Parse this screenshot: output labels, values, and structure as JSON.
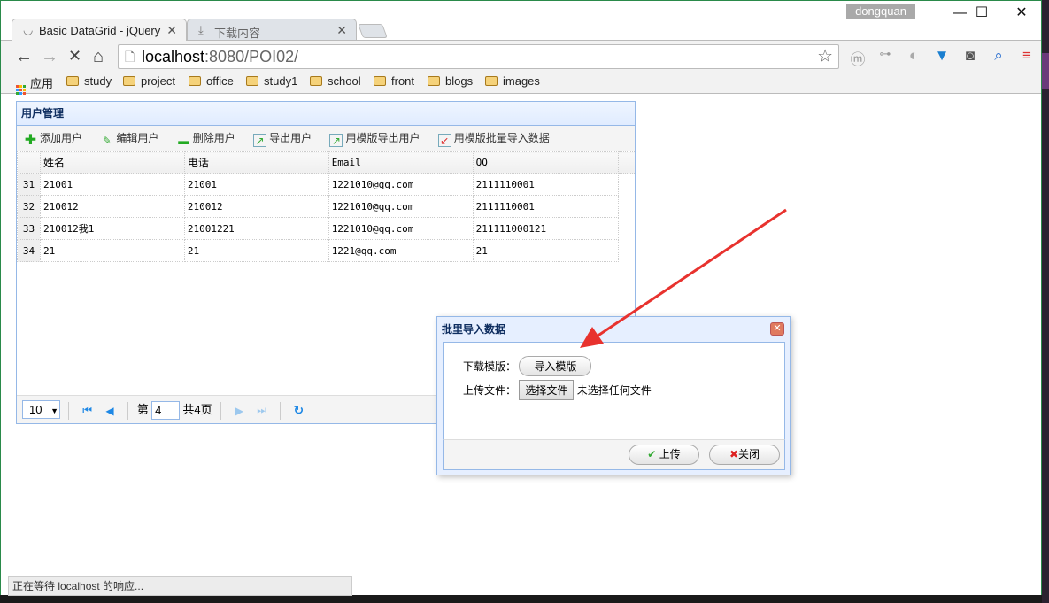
{
  "window": {
    "user": "dongquan",
    "minimize": "—",
    "maximize": "☐",
    "close": "✕"
  },
  "tabs": [
    {
      "label": "Basic DataGrid - jQuery",
      "icon": "loading-spinner-icon",
      "close": "✕"
    },
    {
      "label": "下载内容",
      "icon": "download-icon",
      "close": "✕"
    }
  ],
  "nav": {
    "back": "←",
    "forward": "→",
    "stop": "✕",
    "home": "⌂"
  },
  "omnibox": {
    "host": "localhost",
    "rest": ":8080/POI02/"
  },
  "bookmarks": [
    {
      "label": "应用"
    },
    {
      "label": "study"
    },
    {
      "label": "project"
    },
    {
      "label": "office"
    },
    {
      "label": "study1"
    },
    {
      "label": "school"
    },
    {
      "label": "front"
    },
    {
      "label": "blogs"
    },
    {
      "label": "images"
    }
  ],
  "panel": {
    "title": "用户管理",
    "toolbar": [
      {
        "label": "添加用户",
        "icon": "add-icon"
      },
      {
        "label": "编辑用户",
        "icon": "edit-pencil-icon"
      },
      {
        "label": "删除用户",
        "icon": "remove-icon"
      },
      {
        "label": "导出用户",
        "icon": "export-icon"
      },
      {
        "label": "用模版导出用户",
        "icon": "export-icon"
      },
      {
        "label": "用模版批量导入数据",
        "icon": "import-icon"
      }
    ],
    "columns": [
      "姓名",
      "电话",
      "Email",
      "QQ"
    ],
    "rows": [
      {
        "n": "31",
        "cells": [
          "21001",
          "21001",
          "1221010@qq.com",
          "2111110001"
        ]
      },
      {
        "n": "32",
        "cells": [
          "210012",
          "210012",
          "1221010@qq.com",
          "2111110001"
        ]
      },
      {
        "n": "33",
        "cells": [
          "210012我1",
          "21001221",
          "1221010@qq.com",
          "211111000121"
        ]
      },
      {
        "n": "34",
        "cells": [
          "21",
          "21",
          "1221@qq.com",
          "21"
        ]
      }
    ],
    "pager": {
      "page_size": "10",
      "page_prefix": "第",
      "page": "4",
      "page_total": "共4页"
    }
  },
  "dialog": {
    "title": "批里导入数据",
    "download_label": "下载模版：",
    "download_button": "导入模版",
    "upload_label": "上传文件：",
    "choose_file": "选择文件",
    "no_file": "未选择任何文件",
    "upload_button": "上传",
    "close_button": "关闭"
  },
  "status": "正在等待 localhost 的响应...",
  "colors": {
    "panel_border": "#95b8e7",
    "header_text": "#0e2d5f",
    "arrow": "#e8322e"
  }
}
